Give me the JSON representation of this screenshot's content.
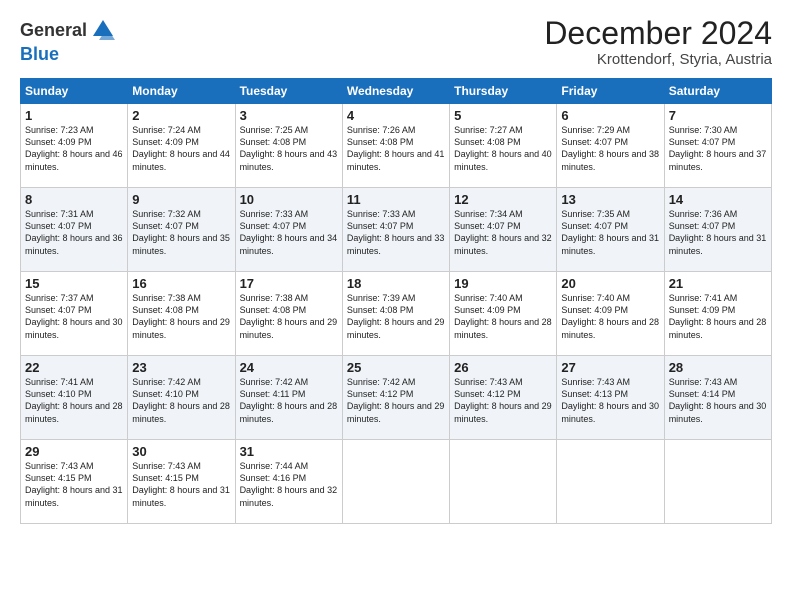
{
  "logo": {
    "general": "General",
    "blue": "Blue"
  },
  "header": {
    "month": "December 2024",
    "location": "Krottendorf, Styria, Austria"
  },
  "days_of_week": [
    "Sunday",
    "Monday",
    "Tuesday",
    "Wednesday",
    "Thursday",
    "Friday",
    "Saturday"
  ],
  "weeks": [
    [
      {
        "day": 1,
        "sunrise": "7:23 AM",
        "sunset": "4:09 PM",
        "daylight": "8 hours and 46 minutes."
      },
      {
        "day": 2,
        "sunrise": "7:24 AM",
        "sunset": "4:09 PM",
        "daylight": "8 hours and 44 minutes."
      },
      {
        "day": 3,
        "sunrise": "7:25 AM",
        "sunset": "4:08 PM",
        "daylight": "8 hours and 43 minutes."
      },
      {
        "day": 4,
        "sunrise": "7:26 AM",
        "sunset": "4:08 PM",
        "daylight": "8 hours and 41 minutes."
      },
      {
        "day": 5,
        "sunrise": "7:27 AM",
        "sunset": "4:08 PM",
        "daylight": "8 hours and 40 minutes."
      },
      {
        "day": 6,
        "sunrise": "7:29 AM",
        "sunset": "4:07 PM",
        "daylight": "8 hours and 38 minutes."
      },
      {
        "day": 7,
        "sunrise": "7:30 AM",
        "sunset": "4:07 PM",
        "daylight": "8 hours and 37 minutes."
      }
    ],
    [
      {
        "day": 8,
        "sunrise": "7:31 AM",
        "sunset": "4:07 PM",
        "daylight": "8 hours and 36 minutes."
      },
      {
        "day": 9,
        "sunrise": "7:32 AM",
        "sunset": "4:07 PM",
        "daylight": "8 hours and 35 minutes."
      },
      {
        "day": 10,
        "sunrise": "7:33 AM",
        "sunset": "4:07 PM",
        "daylight": "8 hours and 34 minutes."
      },
      {
        "day": 11,
        "sunrise": "7:33 AM",
        "sunset": "4:07 PM",
        "daylight": "8 hours and 33 minutes."
      },
      {
        "day": 12,
        "sunrise": "7:34 AM",
        "sunset": "4:07 PM",
        "daylight": "8 hours and 32 minutes."
      },
      {
        "day": 13,
        "sunrise": "7:35 AM",
        "sunset": "4:07 PM",
        "daylight": "8 hours and 31 minutes."
      },
      {
        "day": 14,
        "sunrise": "7:36 AM",
        "sunset": "4:07 PM",
        "daylight": "8 hours and 31 minutes."
      }
    ],
    [
      {
        "day": 15,
        "sunrise": "7:37 AM",
        "sunset": "4:07 PM",
        "daylight": "8 hours and 30 minutes."
      },
      {
        "day": 16,
        "sunrise": "7:38 AM",
        "sunset": "4:08 PM",
        "daylight": "8 hours and 29 minutes."
      },
      {
        "day": 17,
        "sunrise": "7:38 AM",
        "sunset": "4:08 PM",
        "daylight": "8 hours and 29 minutes."
      },
      {
        "day": 18,
        "sunrise": "7:39 AM",
        "sunset": "4:08 PM",
        "daylight": "8 hours and 29 minutes."
      },
      {
        "day": 19,
        "sunrise": "7:40 AM",
        "sunset": "4:09 PM",
        "daylight": "8 hours and 28 minutes."
      },
      {
        "day": 20,
        "sunrise": "7:40 AM",
        "sunset": "4:09 PM",
        "daylight": "8 hours and 28 minutes."
      },
      {
        "day": 21,
        "sunrise": "7:41 AM",
        "sunset": "4:09 PM",
        "daylight": "8 hours and 28 minutes."
      }
    ],
    [
      {
        "day": 22,
        "sunrise": "7:41 AM",
        "sunset": "4:10 PM",
        "daylight": "8 hours and 28 minutes."
      },
      {
        "day": 23,
        "sunrise": "7:42 AM",
        "sunset": "4:10 PM",
        "daylight": "8 hours and 28 minutes."
      },
      {
        "day": 24,
        "sunrise": "7:42 AM",
        "sunset": "4:11 PM",
        "daylight": "8 hours and 28 minutes."
      },
      {
        "day": 25,
        "sunrise": "7:42 AM",
        "sunset": "4:12 PM",
        "daylight": "8 hours and 29 minutes."
      },
      {
        "day": 26,
        "sunrise": "7:43 AM",
        "sunset": "4:12 PM",
        "daylight": "8 hours and 29 minutes."
      },
      {
        "day": 27,
        "sunrise": "7:43 AM",
        "sunset": "4:13 PM",
        "daylight": "8 hours and 30 minutes."
      },
      {
        "day": 28,
        "sunrise": "7:43 AM",
        "sunset": "4:14 PM",
        "daylight": "8 hours and 30 minutes."
      }
    ],
    [
      {
        "day": 29,
        "sunrise": "7:43 AM",
        "sunset": "4:15 PM",
        "daylight": "8 hours and 31 minutes."
      },
      {
        "day": 30,
        "sunrise": "7:43 AM",
        "sunset": "4:15 PM",
        "daylight": "8 hours and 31 minutes."
      },
      {
        "day": 31,
        "sunrise": "7:44 AM",
        "sunset": "4:16 PM",
        "daylight": "8 hours and 32 minutes."
      },
      null,
      null,
      null,
      null
    ]
  ]
}
